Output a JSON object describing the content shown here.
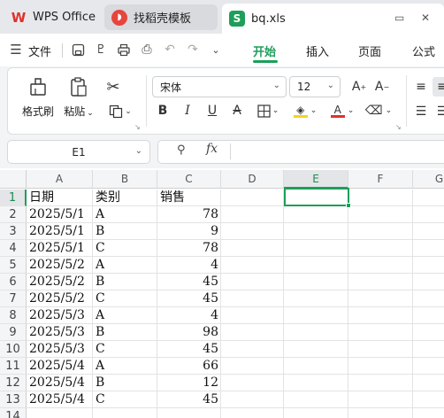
{
  "tabs": {
    "wps_label": "WPS Office",
    "template_label": "找稻壳模板",
    "file_label": "bq.xls",
    "icon_s": "S"
  },
  "menu": {
    "file": "文件",
    "home": "开始",
    "insert": "插入",
    "page": "页面",
    "formula": "公式"
  },
  "ribbon": {
    "format_painter": "格式刷",
    "paste": "粘贴",
    "font_name": "宋体",
    "font_size": "12"
  },
  "formula_bar": {
    "name_box": "E1",
    "fx": "fx",
    "value": ""
  },
  "sheet": {
    "columns": [
      "A",
      "B",
      "C",
      "D",
      "E",
      "F",
      "G"
    ],
    "selected_column": "E",
    "selected_row": 1,
    "rows": [
      {
        "n": "1",
        "a": "日期",
        "b": "类别",
        "c": "销售"
      },
      {
        "n": "2",
        "a": "2025/5/1",
        "b": "A",
        "c": "78"
      },
      {
        "n": "3",
        "a": "2025/5/1",
        "b": "B",
        "c": "9"
      },
      {
        "n": "4",
        "a": "2025/5/1",
        "b": "C",
        "c": "78"
      },
      {
        "n": "5",
        "a": "2025/5/2",
        "b": "A",
        "c": "4"
      },
      {
        "n": "6",
        "a": "2025/5/2",
        "b": "B",
        "c": "45"
      },
      {
        "n": "7",
        "a": "2025/5/2",
        "b": "C",
        "c": "45"
      },
      {
        "n": "8",
        "a": "2025/5/3",
        "b": "A",
        "c": "4"
      },
      {
        "n": "9",
        "a": "2025/5/3",
        "b": "B",
        "c": "98"
      },
      {
        "n": "10",
        "a": "2025/5/3",
        "b": "C",
        "c": "45"
      },
      {
        "n": "11",
        "a": "2025/5/4",
        "b": "A",
        "c": "66"
      },
      {
        "n": "12",
        "a": "2025/5/4",
        "b": "B",
        "c": "12"
      },
      {
        "n": "13",
        "a": "2025/5/4",
        "b": "C",
        "c": "45"
      },
      {
        "n": "14",
        "a": "",
        "b": "",
        "c": ""
      }
    ]
  },
  "colors": {
    "accent": "#1e9e5a",
    "wps_red": "#e0312b"
  }
}
